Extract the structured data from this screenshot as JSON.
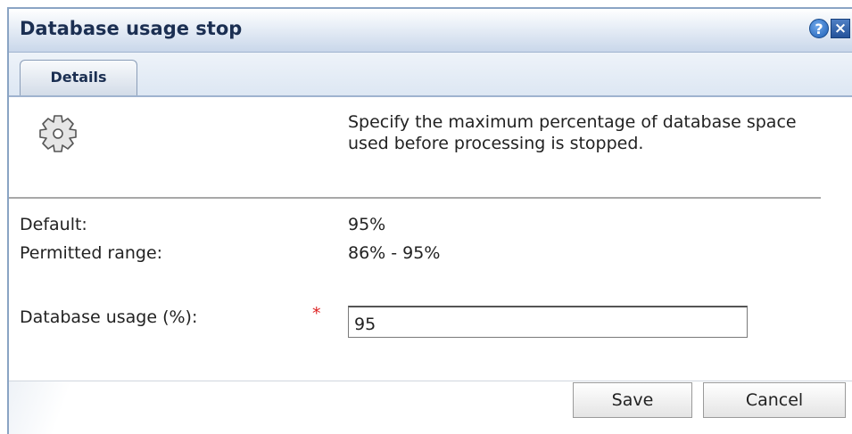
{
  "dialog": {
    "title": "Database usage stop",
    "help_icon": "help-icon",
    "help_glyph": "?",
    "close_icon": "close-icon",
    "close_glyph": "×"
  },
  "tabs": [
    {
      "label": "Details",
      "active": true
    }
  ],
  "details": {
    "icon": "gear-icon",
    "description": "Specify the maximum percentage of database space used before processing is stopped.",
    "default_label": "Default:",
    "default_value": "95%",
    "range_label": "Permitted range:",
    "range_value": "86% - 95%",
    "usage_label": "Database usage (%):",
    "required_marker": "*",
    "usage_value": "95"
  },
  "footer": {
    "save_label": "Save",
    "cancel_label": "Cancel"
  },
  "colors": {
    "title_text": "#1b2f52",
    "required": "#dd2222",
    "border": "#8aa4c4"
  }
}
